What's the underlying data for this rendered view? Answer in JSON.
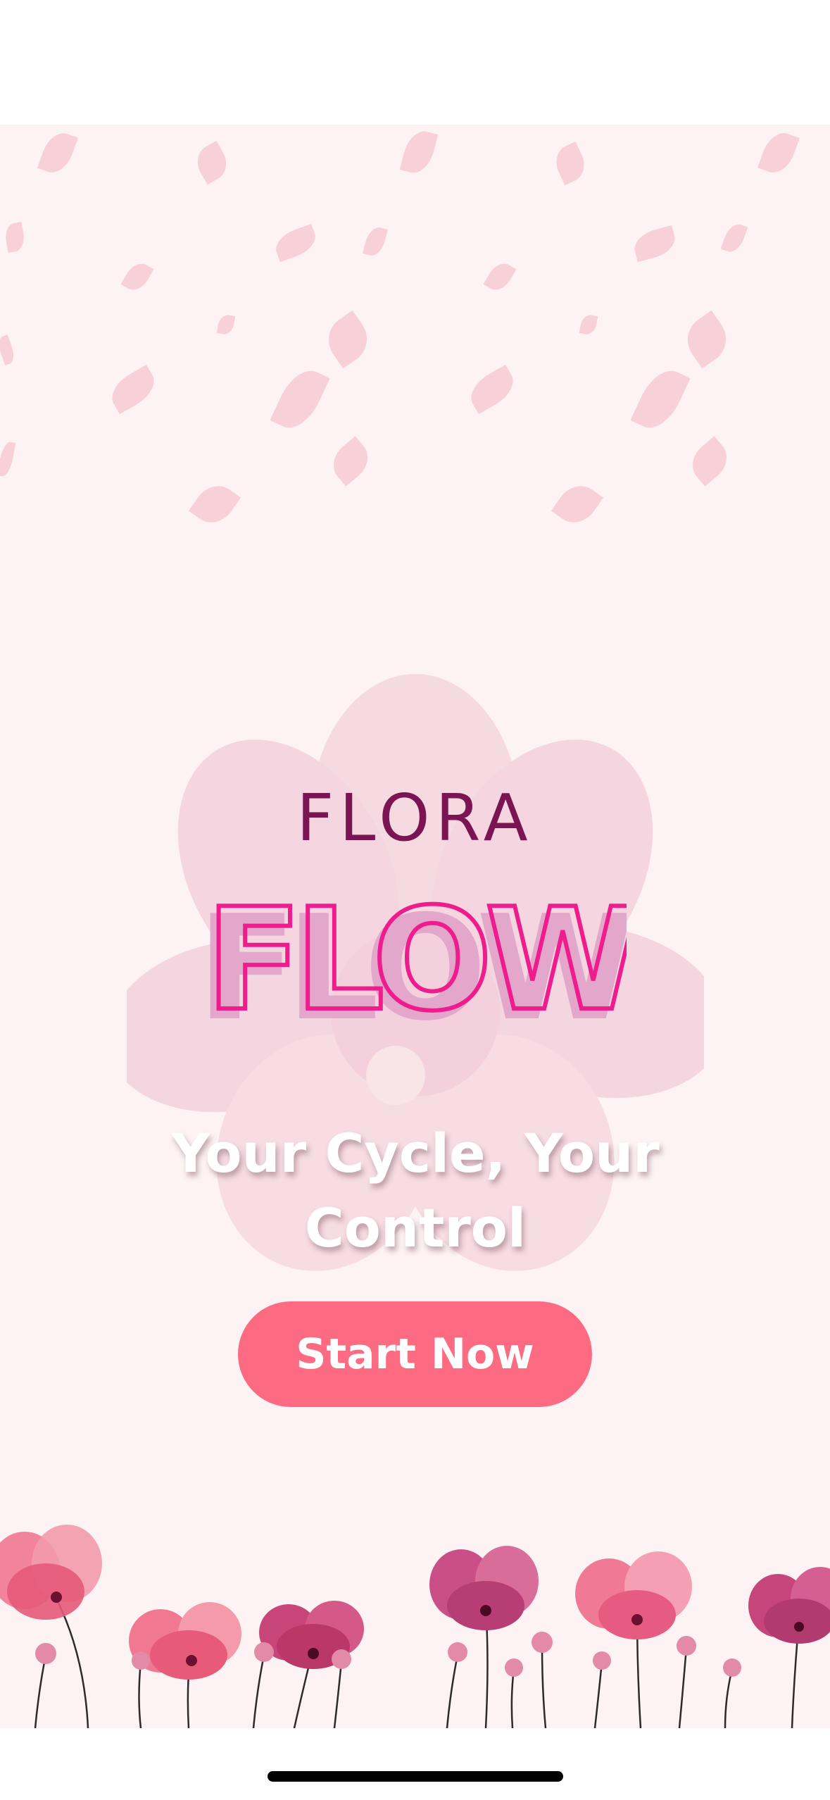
{
  "app": {
    "brand_top": "FLORA",
    "brand_bottom": "FLOW",
    "tagline": "Your Cycle, Your Control",
    "cta_label": "Start Now"
  },
  "colors": {
    "background": "#fdf3f4",
    "petal": "#f6c4cd",
    "flora_text": "#7a1452",
    "flow_outline": "#ee1c8c",
    "flow_fill": "#e3a7cb",
    "button": "#fd6b83",
    "button_text": "#ffffff",
    "tagline_text": "#ffffff"
  },
  "icons": {
    "decor_top": "falling-petals",
    "decor_center": "watercolor-flower",
    "decor_bottom": "flower-border",
    "system": "home-indicator"
  }
}
